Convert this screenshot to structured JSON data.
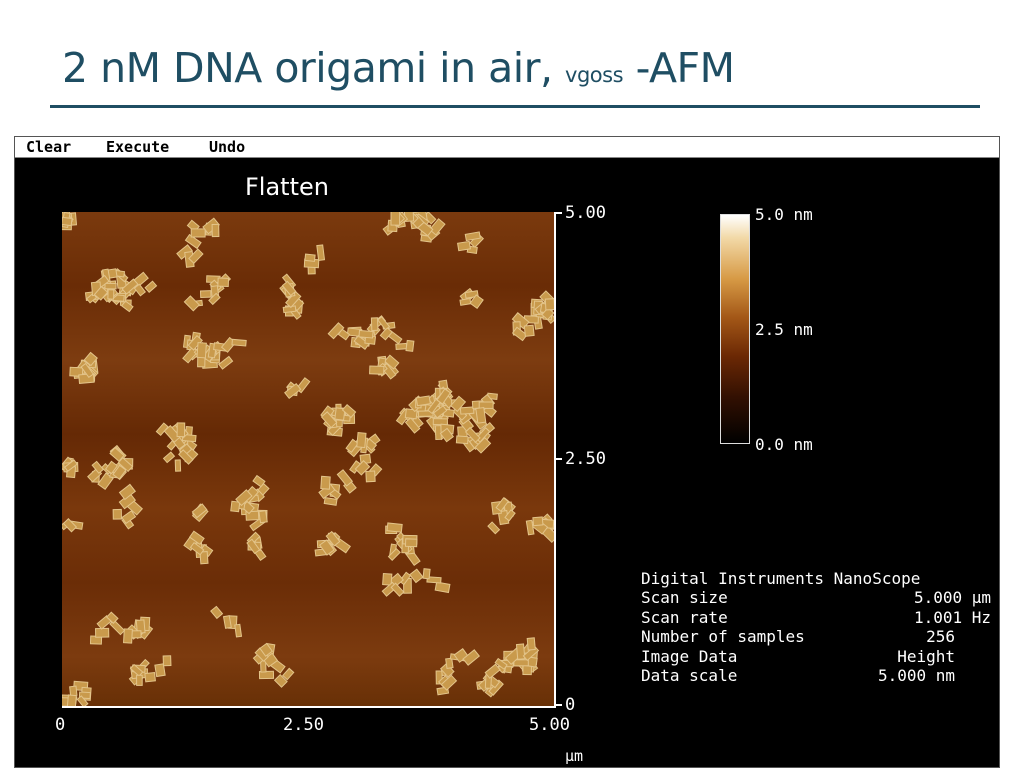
{
  "slide": {
    "title_main": "2 nM DNA origami in air,",
    "title_small": "vgoss",
    "title_tail": "-AFM"
  },
  "menu": {
    "clear": "Clear",
    "execute": "Execute",
    "undo": "Undo"
  },
  "image": {
    "label": "Flatten",
    "y_ticks": [
      "5.00",
      "2.50",
      "0"
    ],
    "x_ticks": [
      "0",
      "2.50",
      "5.00"
    ],
    "x_unit": "µm"
  },
  "color_scale": {
    "top": "5.0 nm",
    "mid": "2.5 nm",
    "bottom": "0.0 nm",
    "colors": [
      "#ffffff",
      "#d79a45",
      "#6b2804",
      "#000000"
    ]
  },
  "info": {
    "header": "Digital Instruments NanoScope",
    "rows": [
      {
        "key": "Scan size",
        "value": "5.000 µm"
      },
      {
        "key": "Scan rate",
        "value": "1.001 Hz"
      },
      {
        "key": "Number of samples",
        "value": "256"
      },
      {
        "key": "Image Data",
        "value": "Height"
      },
      {
        "key": "Data scale",
        "value": "5.000 nm"
      }
    ]
  }
}
